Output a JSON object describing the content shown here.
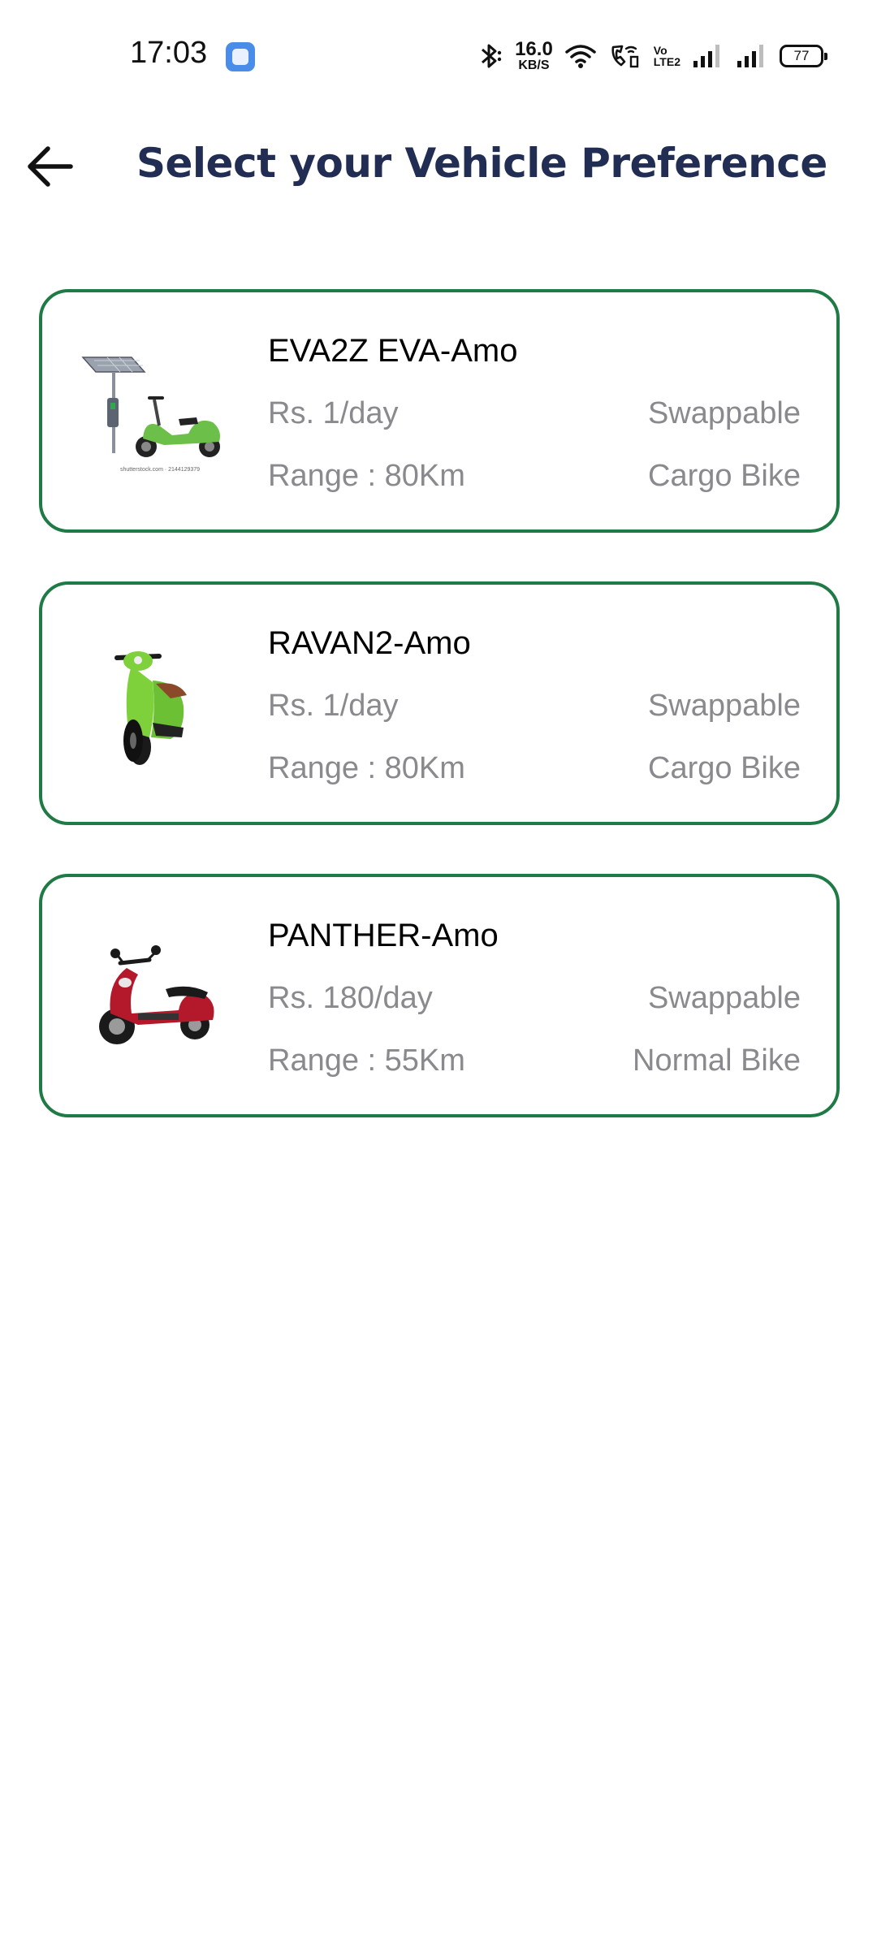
{
  "status_bar": {
    "time": "17:03",
    "net_speed_value": "16.0",
    "net_speed_unit": "KB/S",
    "volte_top": "Vo",
    "volte_bottom": "LTE2",
    "battery": "77"
  },
  "header": {
    "title": "Select your Vehicle Preference"
  },
  "vehicles": [
    {
      "name": "EVA2Z EVA-Amo",
      "price": "Rs. 1/day",
      "battery_type": "Swappable",
      "range": "Range : 80Km",
      "category": "Cargo Bike",
      "image_color": "#6cc04a"
    },
    {
      "name": "RAVAN2-Amo",
      "price": "Rs. 1/day",
      "battery_type": "Swappable",
      "range": "Range : 80Km",
      "category": "Cargo Bike",
      "image_color": "#7fd13b"
    },
    {
      "name": "PANTHER-Amo",
      "price": "Rs. 180/day",
      "battery_type": "Swappable",
      "range": "Range : 55Km",
      "category": "Normal Bike",
      "image_color": "#b3192b"
    }
  ]
}
